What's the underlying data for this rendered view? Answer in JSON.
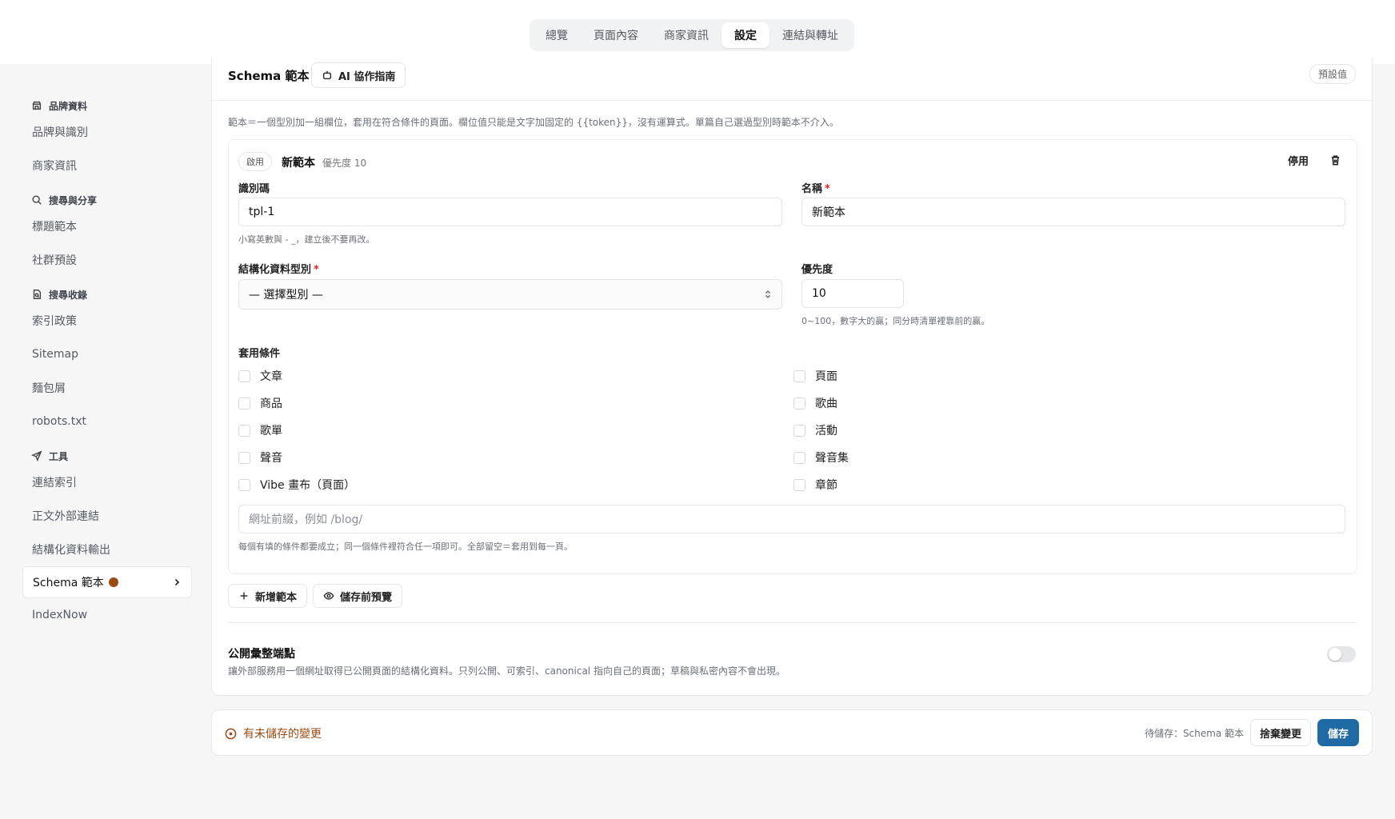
{
  "topnav": {
    "tabs": [
      {
        "label": "總覽"
      },
      {
        "label": "頁面內容"
      },
      {
        "label": "商家資訊"
      },
      {
        "label": "設定"
      },
      {
        "label": "連結與轉址"
      }
    ],
    "active_index": 3
  },
  "sidebar": {
    "groups": [
      {
        "label": "品牌資料",
        "icon": "store-icon",
        "items": [
          "品牌與識別",
          "商家資訊"
        ]
      },
      {
        "label": "搜尋與分享",
        "icon": "search-icon",
        "items": [
          "標題範本",
          "社群預設"
        ]
      },
      {
        "label": "搜尋收錄",
        "icon": "document-search-icon",
        "items": [
          "索引政策",
          "Sitemap",
          "麵包屑",
          "robots.txt"
        ]
      },
      {
        "label": "工具",
        "icon": "send-icon",
        "items": [
          "連結索引",
          "正文外部連結",
          "結構化資料輸出",
          "Schema 範本",
          "IndexNow"
        ]
      }
    ],
    "active_item": "Schema 範本",
    "active_has_unsaved_dot": true
  },
  "card": {
    "title": "Schema 範本",
    "ai_button": "AI 協作指南",
    "default_pill": "預設值",
    "description": "範本＝一個型別加一組欄位，套用在符合條件的頁面。欄位值只能是文字加固定的 {{token}}，沒有運算式。單篇自己選過型別時範本不介入。",
    "template": {
      "status_badge": "啟用",
      "name": "新範本",
      "priority_text": "優先度 10",
      "disable_label": "停用",
      "fields": {
        "id_label": "識別碼",
        "id_value": "tpl-1",
        "id_hint": "小寫英數與 - _，建立後不要再改。",
        "name_label": "名稱",
        "name_value": "新範本",
        "type_label": "結構化資料型別",
        "type_value": "— 選擇型別 —",
        "priority_label": "優先度",
        "priority_value": "10",
        "priority_hint": "0~100，數字大的贏；同分時清單裡靠前的贏。"
      },
      "conditions_label": "套用條件",
      "conditions": [
        {
          "label": "文章",
          "checked": false
        },
        {
          "label": "頁面",
          "checked": false
        },
        {
          "label": "商品",
          "checked": false
        },
        {
          "label": "歌曲",
          "checked": false
        },
        {
          "label": "歌單",
          "checked": false
        },
        {
          "label": "活動",
          "checked": false
        },
        {
          "label": "聲音",
          "checked": false
        },
        {
          "label": "聲音集",
          "checked": false
        },
        {
          "label": "Vibe 畫布（頁面）",
          "checked": false
        },
        {
          "label": "章節",
          "checked": false
        }
      ],
      "url_prefix_placeholder": "網址前綴，例如 /blog/",
      "conditions_hint": "每個有填的條件都要成立；同一個條件裡符合任一項即可。全部留空＝套用到每一頁。"
    },
    "add_button": "新增範本",
    "preview_button": "儲存前預覽",
    "public_endpoint": {
      "title": "公開彙整端點",
      "description": "讓外部服務用一個網址取得已公開頁面的結構化資料。只列公開、可索引、canonical 指向自己的頁面；草稿與私密內容不會出現。",
      "enabled": false
    }
  },
  "savebar": {
    "unsaved_text": "有未儲存的變更",
    "pending_text": "待儲存：Schema 範本",
    "discard_label": "捨棄變更",
    "save_label": "儲存"
  },
  "colors": {
    "accent": "#1f6aa5",
    "unsaved": "#9a4a12",
    "required": "#dd2222"
  }
}
